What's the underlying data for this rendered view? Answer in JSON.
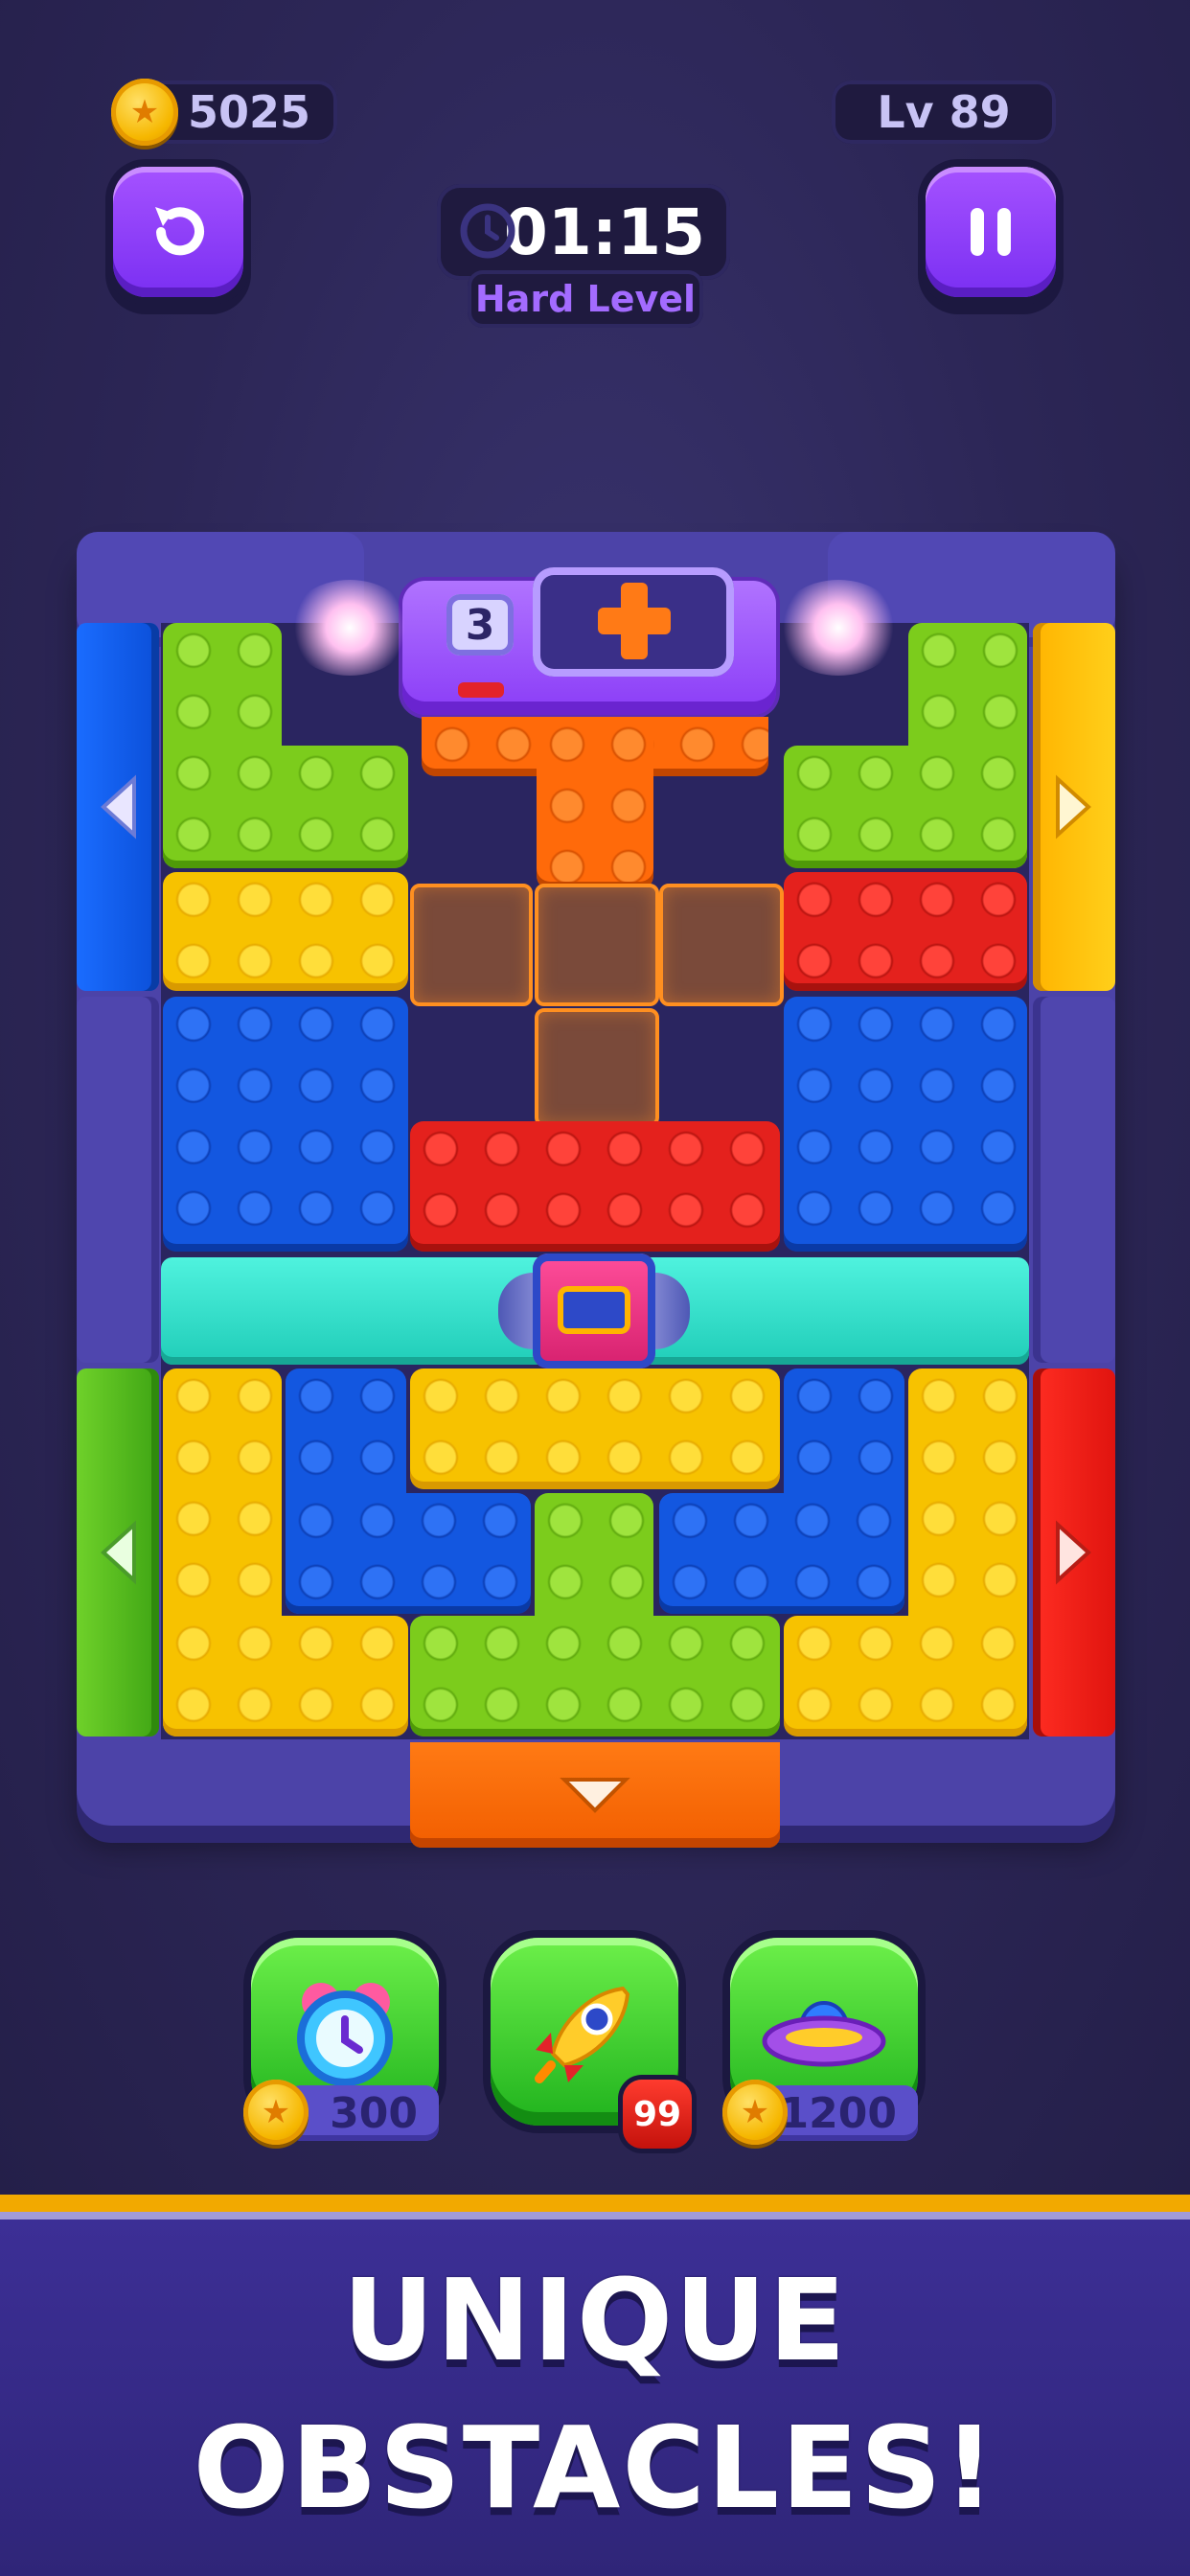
{
  "hud": {
    "coins": "5025",
    "level": "Lv 89",
    "timer": "01:15",
    "difficulty": "Hard Level"
  },
  "obstacle": {
    "counter": "3"
  },
  "boosters": [
    {
      "name": "clock",
      "price": "300"
    },
    {
      "name": "rocket",
      "badge": "99"
    },
    {
      "name": "ufo",
      "price": "1200"
    }
  ],
  "banner": {
    "line1": "UNIQUE",
    "line2": "OBSTACLES!"
  },
  "colors": {
    "background": "#2b2552",
    "frame": "#4c43a8",
    "accent_purple": "#8a3cf7",
    "gold": "#f6b700"
  }
}
